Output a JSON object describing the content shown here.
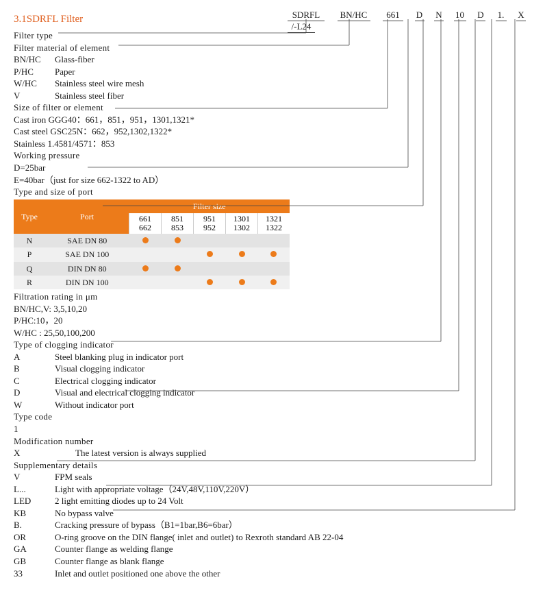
{
  "title": "3.1SDRFL Filter",
  "part_code": {
    "p1": "SDRFL",
    "p2": "BN/HC",
    "p3": "661",
    "p4": "D",
    "p5": "N",
    "p6": "10",
    "p7": "D",
    "p8": "1.",
    "p9": "X",
    "p10": "/-L24"
  },
  "sections": {
    "filter_type": "Filter type",
    "filter_material": "Filter material of element",
    "materials": [
      {
        "code": "BN/HC",
        "desc": "Glass-fiber"
      },
      {
        "code": "P/HC",
        "desc": "Paper"
      },
      {
        "code": "W/HC",
        "desc": "Stainless steel wire mesh"
      },
      {
        "code": "V",
        "desc": "Stainless steel fiber"
      }
    ],
    "size_head": "Size of filter or element",
    "size_lines": [
      "Cast iron GGG40：661，851，951，1301,1321*",
      "Cast steel GSC25N：662，952,1302,1322*",
      "Stainless 1.4581/4571：853"
    ],
    "working_pressure": "Working pressure",
    "wp_lines": [
      "D=25bar",
      "E=40bar（just for size 662-1322 to AD）"
    ],
    "port_head": "Type and size of port",
    "filtration_head": "Filtration rating in μm",
    "filtration_lines": [
      "BN/HC,V: 3,5,10,20",
      "P/HC:10，20",
      "W/HC : 25,50,100,200"
    ],
    "clogging_head": "Type of clogging indicator",
    "clogging": [
      {
        "code": "A",
        "desc": "Steel blanking plug in indicator port"
      },
      {
        "code": "B",
        "desc": "Visual clogging indicator"
      },
      {
        "code": "C",
        "desc": "Electrical clogging indicator"
      },
      {
        "code": "D",
        "desc": "Visual and electrical clogging indicator"
      },
      {
        "code": "W",
        "desc": "Without indicator port"
      }
    ],
    "typecode_head": "Type code",
    "typecode_val": "1",
    "mod_head": "Modification number",
    "mod_row": {
      "code": "X",
      "desc": "The latest version is always supplied"
    },
    "supp_head": "Supplementary details",
    "supp": [
      {
        "code": "V",
        "desc": "FPM seals"
      },
      {
        "code": "L...",
        "desc": "Light with appropriate voltage（24V,48V,110V,220V）"
      },
      {
        "code": "LED",
        "desc": "2 light emitting diodes up to 24 Volt"
      },
      {
        "code": "KB",
        "desc": "No bypass valve"
      },
      {
        "code": "B.",
        "desc": "Cracking pressure of bypass（B1=1bar,B6=6bar）"
      },
      {
        "code": "OR",
        "desc": "O-ring groove on the DIN flange( inlet and outlet) to Rexroth standard AB 22-04"
      },
      {
        "code": "GA",
        "desc": "Counter flange as welding flange"
      },
      {
        "code": "GB",
        "desc": "Counter flange as blank flange"
      },
      {
        "code": "33",
        "desc": "Inlet and outlet positioned one above the other"
      }
    ]
  },
  "chart_data": {
    "type": "table",
    "title": "Filter size",
    "col_headers": {
      "type": "Type",
      "port": "Port",
      "sizes": [
        {
          "top": "661",
          "bot": "662"
        },
        {
          "top": "851",
          "bot": "853"
        },
        {
          "top": "951",
          "bot": "952"
        },
        {
          "top": "1301",
          "bot": "1302"
        },
        {
          "top": "1321",
          "bot": "1322"
        }
      ]
    },
    "rows": [
      {
        "type": "N",
        "port": "SAE DN 80",
        "cells": [
          true,
          true,
          false,
          false,
          false
        ]
      },
      {
        "type": "P",
        "port": "SAE DN 100",
        "cells": [
          false,
          false,
          true,
          true,
          true
        ]
      },
      {
        "type": "Q",
        "port": "DIN DN 80",
        "cells": [
          true,
          true,
          false,
          false,
          false
        ]
      },
      {
        "type": "R",
        "port": "DIN DN 100",
        "cells": [
          false,
          false,
          true,
          true,
          true
        ]
      }
    ]
  }
}
